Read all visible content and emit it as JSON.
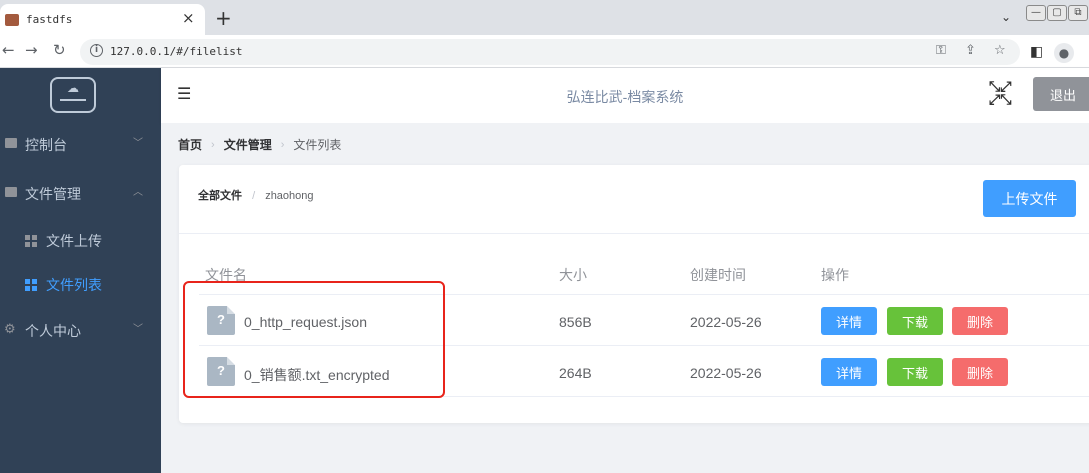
{
  "browser": {
    "tab_title": "fastdfs",
    "tab_close": "×",
    "new_tab": "+",
    "url": "127.0.0.1/#/filelist",
    "tab_menu": "⌄",
    "win_buttons": [
      "—",
      "▢",
      "⧉"
    ]
  },
  "sidebar": {
    "items": [
      {
        "label": "控制台"
      },
      {
        "label": "文件管理"
      },
      {
        "label": "文件上传"
      },
      {
        "label": "文件列表"
      },
      {
        "label": "个人中心"
      }
    ]
  },
  "header": {
    "title": "弘连比武-档案系统",
    "logout": "退出"
  },
  "breadcrumb": {
    "items": [
      "首页",
      "文件管理",
      "文件列表"
    ]
  },
  "path": {
    "root": "全部文件",
    "sep": "/",
    "current": "zhaohong"
  },
  "upload_button": "上传文件",
  "table": {
    "headers": [
      "文件名",
      "大小",
      "创建时间",
      "操作"
    ],
    "rows": [
      {
        "name": "0_http_request.json",
        "size": "856B",
        "date": "2022-05-26"
      },
      {
        "name": "0_销售额.txt_encrypted",
        "size": "264B",
        "date": "2022-05-26"
      }
    ],
    "actions": {
      "detail": "详情",
      "download": "下载",
      "delete": "删除"
    },
    "file_icon_glyph": "?"
  },
  "colors": {
    "sidebar_bg": "#304156",
    "active": "#409eff",
    "primary": "#409eff",
    "success": "#67c23a",
    "danger": "#f56c6c",
    "highlight": "#e8241b"
  }
}
